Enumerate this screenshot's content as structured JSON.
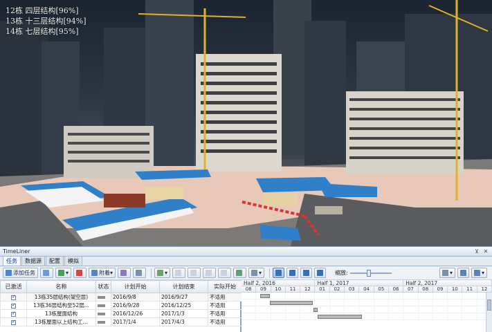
{
  "overlay": {
    "lines": [
      "12栋 四层结构[96%]",
      "13栋 十三层结构[94%]",
      "14栋 七层结构[95%]"
    ]
  },
  "panel": {
    "title": "TimeLiner",
    "tabs": [
      "任务",
      "数据源",
      "配置",
      "模拟"
    ],
    "active_tab": 0
  },
  "toolbar": {
    "add_task": "添加任务",
    "attach": "附着",
    "zoom_label": "缩放:"
  },
  "table": {
    "headers": [
      "已激活",
      "名称",
      "状态",
      "计划开始",
      "计划结束",
      "实际开始"
    ],
    "rows": [
      {
        "name": "13栋35层结构(架空层)",
        "plan_start": "2016/9/8",
        "plan_end": "2016/9/27",
        "actual_start": "不适用"
      },
      {
        "name": "13栋36层结构至52层...",
        "plan_start": "2016/9/28",
        "plan_end": "2016/12/25",
        "actual_start": "不适用"
      },
      {
        "name": "13栋屋面结构",
        "plan_start": "2016/12/26",
        "plan_end": "2017/1/3",
        "actual_start": "不适用"
      },
      {
        "name": "13栋屋面以上结构工...",
        "plan_start": "2017/1/4",
        "plan_end": "2017/4/3",
        "actual_start": "不适用"
      }
    ]
  },
  "gantt": {
    "periods": [
      "Half 2, 2016",
      "Half 1, 2017",
      "Half 2, 2017"
    ],
    "months": [
      "08",
      "09",
      "10",
      "11",
      "12",
      "01",
      "02",
      "03",
      "04",
      "05",
      "06",
      "07",
      "08",
      "09",
      "10",
      "11",
      "12"
    ],
    "bars": [
      {
        "start_month": 1.25,
        "end_month": 1.9
      },
      {
        "start_month": 1.9,
        "end_month": 4.8
      },
      {
        "start_month": 4.85,
        "end_month": 5.1
      },
      {
        "start_month": 5.1,
        "end_month": 8.1
      }
    ]
  }
}
